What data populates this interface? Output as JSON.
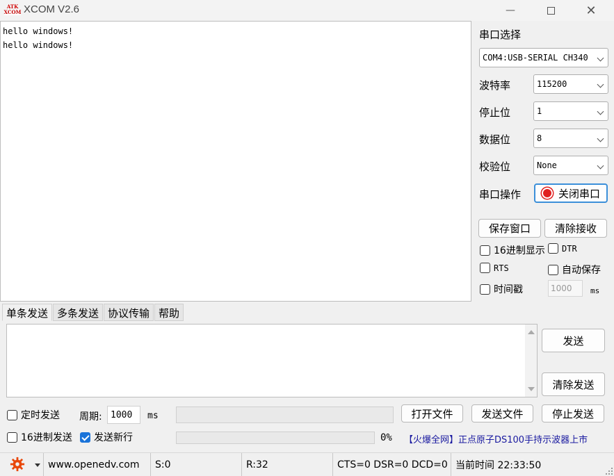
{
  "window": {
    "title": "XCOM V2.6",
    "logo_line1": "ATK",
    "logo_line2": "XCOM"
  },
  "receive": {
    "lines": [
      "hello windows!",
      "hello windows!"
    ]
  },
  "serial": {
    "section_label": "串口选择",
    "port": "COM4:USB-SERIAL CH340",
    "baud_label": "波特率",
    "baud": "115200",
    "stop_label": "停止位",
    "stop": "1",
    "data_label": "数据位",
    "data": "8",
    "parity_label": "校验位",
    "parity": "None",
    "op_label": "串口操作",
    "op_button": "关闭串口",
    "status_color": "#e02020"
  },
  "actions": {
    "save_window": "保存窗口",
    "clear_recv": "清除接收"
  },
  "options": {
    "hex_display": "16进制显示",
    "dtr": "DTR",
    "rts": "RTS",
    "auto_save": "自动保存",
    "timestamp": "时间戳",
    "timestamp_value": "1000",
    "timestamp_unit": "ms"
  },
  "tabs": [
    "单条发送",
    "多条发送",
    "协议传输",
    "帮助"
  ],
  "send": {
    "send_button": "发送",
    "clear_send_button": "清除发送",
    "timed_send": "定时发送",
    "period_label": "周期:",
    "period_value": "1000",
    "period_unit": "ms",
    "open_file": "打开文件",
    "send_file": "发送文件",
    "stop_send": "停止发送",
    "hex_send": "16进制发送",
    "send_newline": "发送新行",
    "progress_text": "0%",
    "progress": 0,
    "promo": "【火爆全网】正点原子DS100手持示波器上市"
  },
  "status": {
    "url": "www.openedv.com",
    "sent": "S:0",
    "received": "R:32",
    "lines": "CTS=0 DSR=0 DCD=0",
    "time": "当前时间 22:33:50"
  },
  "colors": {
    "accent": "#1a73d9",
    "promo": "#1a1aa0"
  }
}
